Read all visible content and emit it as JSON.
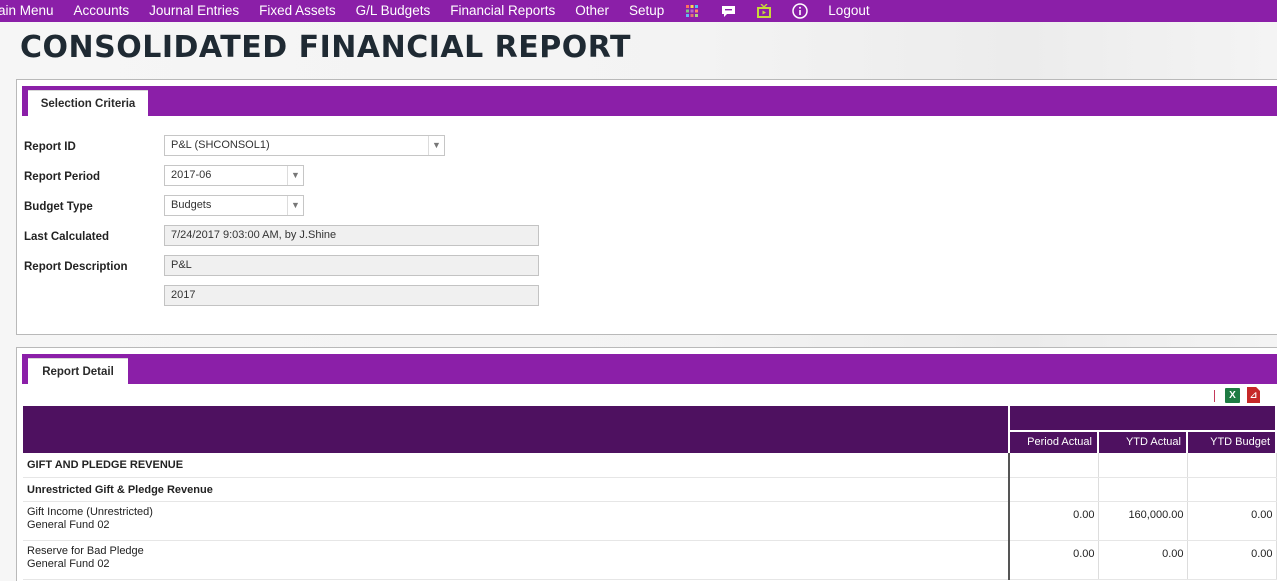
{
  "nav": {
    "items": [
      "ain Menu",
      "Accounts",
      "Journal Entries",
      "Fixed Assets",
      "G/L Budgets",
      "Financial Reports",
      "Other",
      "Setup"
    ],
    "logout": "Logout",
    "icons": [
      "grid-icon",
      "chat-icon",
      "tv-icon",
      "info-icon"
    ]
  },
  "page": {
    "title": "CONSOLIDATED FINANCIAL REPORT"
  },
  "criteria": {
    "tab_label": "Selection Criteria",
    "report_id_label": "Report ID",
    "report_id_value": "P&L (SHCONSOL1)",
    "report_period_label": "Report Period",
    "report_period_value": "2017-06",
    "budget_type_label": "Budget Type",
    "budget_type_value": "Budgets",
    "last_calculated_label": "Last Calculated",
    "last_calculated_value": "7/24/2017 9:03:00 AM, by J.Shine",
    "description_label": "Report Description",
    "description_line1": "P&L",
    "description_line2": "2017"
  },
  "detail": {
    "tab_label": "Report Detail",
    "export_icons": [
      "excel-icon",
      "pdf-icon"
    ],
    "columns": [
      "Period Actual",
      "YTD Actual",
      "YTD Budget"
    ],
    "rows": [
      {
        "type": "section",
        "desc": "GIFT AND PLEDGE REVENUE"
      },
      {
        "type": "section",
        "desc": "Unrestricted Gift & Pledge Revenue"
      },
      {
        "type": "line",
        "desc": "Gift Income (Unrestricted)",
        "sub": "General Fund 02",
        "period_actual": "0.00",
        "ytd_actual": "160,000.00",
        "ytd_budget": "0.00"
      },
      {
        "type": "line",
        "desc": "Reserve for Bad Pledge",
        "sub": "General Fund 02",
        "period_actual": "0.00",
        "ytd_actual": "0.00",
        "ytd_budget": "0.00"
      }
    ]
  },
  "colors": {
    "nav_purple": "#8b1fa8",
    "header_dark_purple": "#4e1160",
    "excel_green": "#1e7b43",
    "pdf_red": "#c62828"
  }
}
